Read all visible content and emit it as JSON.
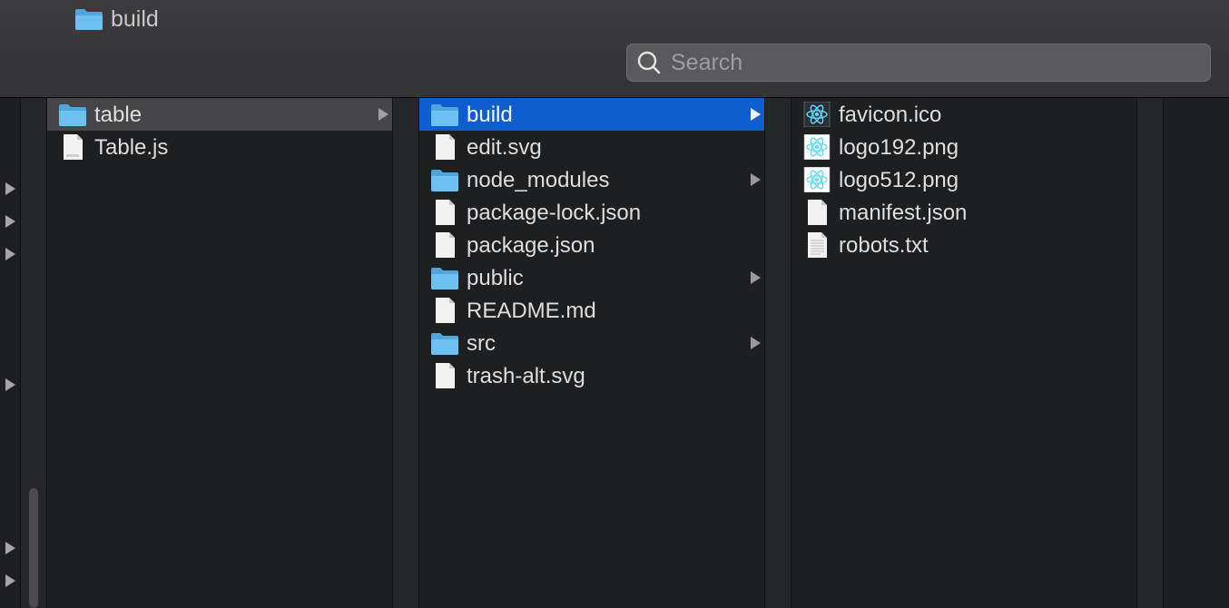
{
  "window": {
    "title": "build"
  },
  "search": {
    "placeholder": "Search",
    "value": ""
  },
  "columns": [
    {
      "items": [
        {
          "label": "table",
          "type": "folder",
          "selected": "inactive",
          "has_children": true
        },
        {
          "label": "Table.js",
          "type": "file-js"
        }
      ]
    },
    {
      "items": [
        {
          "label": "build",
          "type": "folder",
          "selected": "active",
          "has_children": true
        },
        {
          "label": "edit.svg",
          "type": "file"
        },
        {
          "label": "node_modules",
          "type": "folder",
          "has_children": true
        },
        {
          "label": "package-lock.json",
          "type": "file"
        },
        {
          "label": "package.json",
          "type": "file"
        },
        {
          "label": "public",
          "type": "folder",
          "has_children": true
        },
        {
          "label": "README.md",
          "type": "file"
        },
        {
          "label": "src",
          "type": "folder",
          "has_children": true
        },
        {
          "label": "trash-alt.svg",
          "type": "file"
        }
      ]
    },
    {
      "items": [
        {
          "label": "favicon.ico",
          "type": "react-icon"
        },
        {
          "label": "logo192.png",
          "type": "react-icon"
        },
        {
          "label": "logo512.png",
          "type": "react-icon"
        },
        {
          "label": "manifest.json",
          "type": "file"
        },
        {
          "label": "robots.txt",
          "type": "text-file"
        }
      ]
    }
  ],
  "colors": {
    "selection_active": "#0f5ecf",
    "selection_inactive": "#464649",
    "folder": "#5fb5e6",
    "react": "#61dafb"
  }
}
